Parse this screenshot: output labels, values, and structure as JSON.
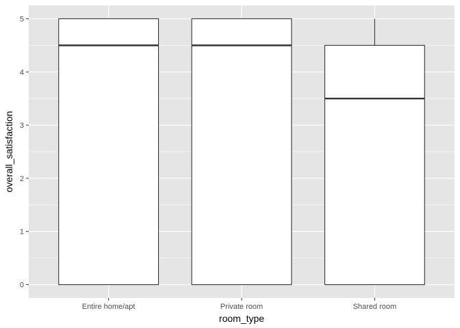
{
  "chart_data": {
    "type": "boxplot",
    "title": "",
    "xlabel": "room_type",
    "ylabel": "overall_satisfaction",
    "categories": [
      "Entire home/apt",
      "Private room",
      "Shared room"
    ],
    "boxes": [
      {
        "category": "Entire home/apt",
        "lower_whisker": 0,
        "q1": 0,
        "median": 4.5,
        "q3": 5,
        "upper_whisker": 5
      },
      {
        "category": "Private room",
        "lower_whisker": 0,
        "q1": 0,
        "median": 4.5,
        "q3": 5,
        "upper_whisker": 5
      },
      {
        "category": "Shared room",
        "lower_whisker": 0,
        "q1": 0,
        "median": 3.5,
        "q3": 4.5,
        "upper_whisker": 5
      }
    ],
    "yticks": [
      0,
      1,
      2,
      3,
      4,
      5
    ],
    "ylim": [
      -0.25,
      5.25
    ],
    "grid": true,
    "legend": "none",
    "colors": {
      "panel_background": "#e5e5e5",
      "grid_major": "#ffffff",
      "box_fill": "#ffffff",
      "box_stroke": "#333333",
      "tick_label": "#4d4d4d",
      "axis_title": "#000000"
    }
  }
}
